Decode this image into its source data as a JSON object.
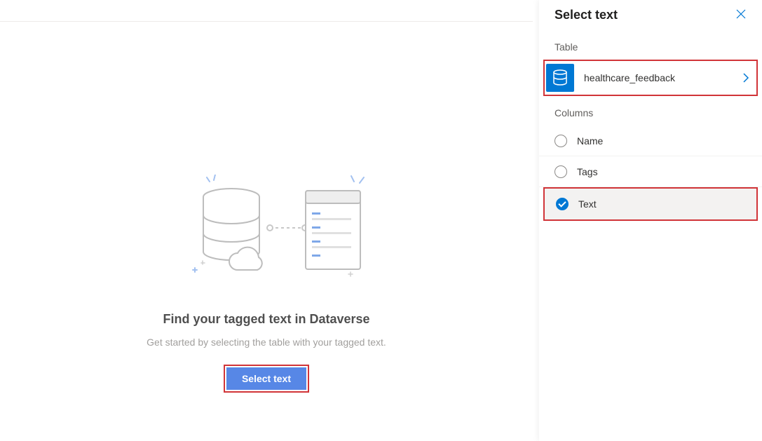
{
  "main": {
    "heading": "Find your tagged text in Dataverse",
    "subheading": "Get started by selecting the table with your tagged text.",
    "select_button": "Select text"
  },
  "panel": {
    "title": "Select text",
    "table_label": "Table",
    "columns_label": "Columns",
    "table": {
      "name": "healthcare_feedback"
    },
    "columns": [
      {
        "label": "Name",
        "selected": false
      },
      {
        "label": "Tags",
        "selected": false
      },
      {
        "label": "Text",
        "selected": true
      }
    ]
  }
}
